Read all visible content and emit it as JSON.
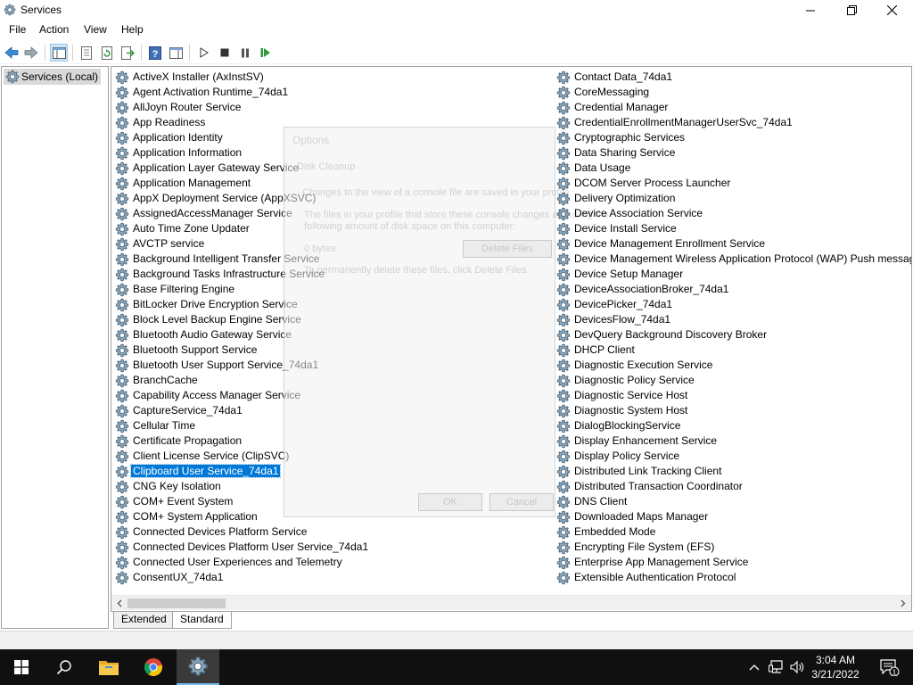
{
  "window": {
    "title": "Services",
    "icon": "services-gear-icon"
  },
  "menu": [
    "File",
    "Action",
    "View",
    "Help"
  ],
  "toolbar": {
    "icons": [
      "back-arrow-icon",
      "forward-arrow-icon",
      "show-hide-console-tree-icon",
      "properties-icon",
      "refresh-icon",
      "export-list-icon",
      "help-icon",
      "show-hide-action-pane-icon",
      "start-service-icon",
      "stop-service-icon",
      "pause-service-icon",
      "restart-service-icon"
    ]
  },
  "tree": {
    "root_label": "Services (Local)"
  },
  "services_col1": [
    "ActiveX Installer (AxInstSV)",
    "Agent Activation Runtime_74da1",
    "AllJoyn Router Service",
    "App Readiness",
    "Application Identity",
    "Application Information",
    "Application Layer Gateway Service",
    "Application Management",
    "AppX Deployment Service (AppXSVC)",
    "AssignedAccessManager Service",
    "Auto Time Zone Updater",
    "AVCTP service",
    "Background Intelligent Transfer Service",
    "Background Tasks Infrastructure Service",
    "Base Filtering Engine",
    "BitLocker Drive Encryption Service",
    "Block Level Backup Engine Service",
    "Bluetooth Audio Gateway Service",
    "Bluetooth Support Service",
    "Bluetooth User Support Service_74da1",
    "BranchCache",
    "Capability Access Manager Service",
    "CaptureService_74da1",
    "Cellular Time",
    "Certificate Propagation",
    "Client License Service (ClipSVC)",
    "Clipboard User Service_74da1",
    "CNG Key Isolation",
    "COM+ Event System",
    "COM+ System Application",
    "Connected Devices Platform Service",
    "Connected Devices Platform User Service_74da1",
    "Connected User Experiences and Telemetry",
    "ConsentUX_74da1"
  ],
  "services_col2": [
    "Contact Data_74da1",
    "CoreMessaging",
    "Credential Manager",
    "CredentialEnrollmentManagerUserSvc_74da1",
    "Cryptographic Services",
    "Data Sharing Service",
    "Data Usage",
    "DCOM Server Process Launcher",
    "Delivery Optimization",
    "Device Association Service",
    "Device Install Service",
    "Device Management Enrollment Service",
    "Device Management Wireless Application Protocol (WAP) Push message",
    "Device Setup Manager",
    "DeviceAssociationBroker_74da1",
    "DevicePicker_74da1",
    "DevicesFlow_74da1",
    "DevQuery Background Discovery Broker",
    "DHCP Client",
    "Diagnostic Execution Service",
    "Diagnostic Policy Service",
    "Diagnostic Service Host",
    "Diagnostic System Host",
    "DialogBlockingService",
    "Display Enhancement Service",
    "Display Policy Service",
    "Distributed Link Tracking Client",
    "Distributed Transaction Coordinator",
    "DNS Client",
    "Downloaded Maps Manager",
    "Embedded Mode",
    "Encrypting File System (EFS)",
    "Enterprise App Management Service",
    "Extensible Authentication Protocol"
  ],
  "selected_service": "Clipboard User Service_74da1",
  "ghost_dialog": {
    "title": "Options",
    "section": "Disk Cleanup",
    "line1": "Changes to the view of a console file are saved in your profile.",
    "line2a": "The files in your profile that store these console changes are using the",
    "line2b": "following amount of disk space on this computer:",
    "size": "0 bytes",
    "delete_files_button": "Delete Files",
    "line3": "To permanently delete these files, click Delete Files.",
    "ok": "OK",
    "cancel": "Cancel"
  },
  "tabs": [
    "Extended",
    "Standard"
  ],
  "taskbar": {
    "time": "3:04 AM",
    "date": "3/21/2022",
    "notification_count": "1",
    "apps": [
      "start-icon",
      "search-icon",
      "file-explorer-icon",
      "chrome-icon",
      "services-icon"
    ]
  },
  "colors": {
    "selection": "#0078d7",
    "taskbar": "#101010",
    "tree_selection": "#d9d9d9"
  }
}
